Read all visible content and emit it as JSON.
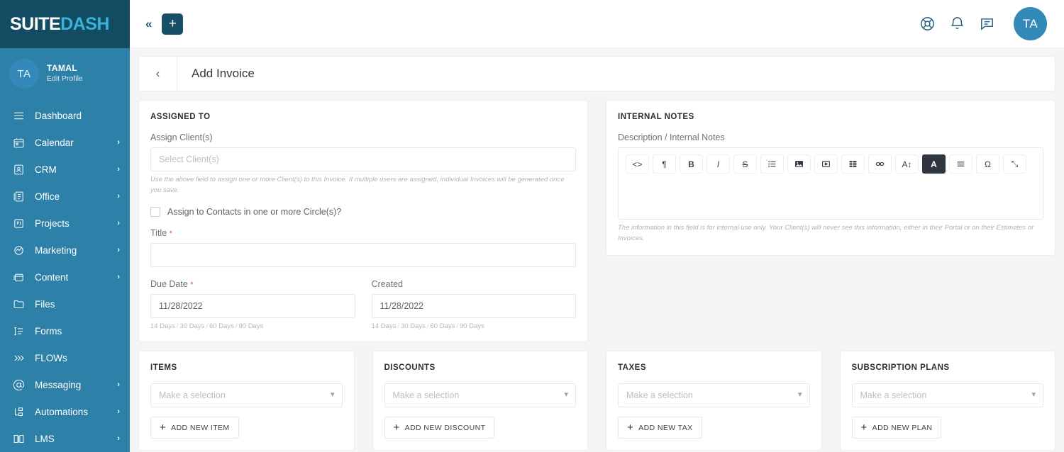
{
  "brand": {
    "logo_part1": "SUITE",
    "logo_part2": "DASH",
    "accent_dark": "#134b63",
    "accent_blue": "#2d80a8",
    "avatar_blue": "#3389b8"
  },
  "sidebar": {
    "profile": {
      "initials": "TA",
      "name": "TAMAL",
      "subtitle": "Edit Profile"
    },
    "items": [
      {
        "label": "Dashboard",
        "icon": "hamburger-icon",
        "caret": ""
      },
      {
        "label": "Calendar",
        "icon": "calendar-icon",
        "caret": "›"
      },
      {
        "label": "CRM",
        "icon": "contact-card-icon",
        "caret": "›"
      },
      {
        "label": "Office",
        "icon": "office-document-icon",
        "caret": "›"
      },
      {
        "label": "Projects",
        "icon": "projects-board-icon",
        "caret": "›"
      },
      {
        "label": "Marketing",
        "icon": "marketing-megaphone-icon",
        "caret": "›"
      },
      {
        "label": "Content",
        "icon": "content-window-icon",
        "caret": "›"
      },
      {
        "label": "Files",
        "icon": "folder-icon",
        "caret": ""
      },
      {
        "label": "Forms",
        "icon": "forms-list-icon",
        "caret": ""
      },
      {
        "label": "FLOWs",
        "icon": "chevrons-right-icon",
        "caret": ""
      },
      {
        "label": "Messaging",
        "icon": "at-sign-icon",
        "caret": "›"
      },
      {
        "label": "Automations",
        "icon": "automations-node-icon",
        "caret": "›"
      },
      {
        "label": "LMS",
        "icon": "book-icon",
        "caret": "›"
      }
    ]
  },
  "topbar": {
    "collapse_label": "«",
    "add_label": "+",
    "icons": [
      "life-ring-icon",
      "bell-icon",
      "chat-icon"
    ],
    "avatar_initials": "TA"
  },
  "page": {
    "back_label": "‹",
    "title": "Add Invoice"
  },
  "assigned_to": {
    "card_title": "ASSIGNED TO",
    "assign_label": "Assign Client(s)",
    "assign_placeholder": "Select Client(s)",
    "assign_value": "",
    "assign_help": "Use the above field to assign one or more Client(s) to this Invoice. If multiple users are assigned, individual Invoices will be generated once you save.",
    "circle_checkbox_label": "Assign to Contacts in one or more Circle(s)?",
    "title_label": "Title",
    "title_required": "*",
    "title_value": "",
    "due_date_label": "Due Date",
    "due_date_required": "*",
    "due_date_value": "11/28/2022",
    "created_label": "Created",
    "created_value": "11/28/2022",
    "day_links": [
      "14 Days",
      "30 Days",
      "60 Days",
      "90 Days"
    ],
    "day_sep": "/"
  },
  "internal_notes": {
    "card_title": "INTERNAL NOTES",
    "field_label": "Description / Internal Notes",
    "content": "",
    "help": "The information in this field is for internal use only. Your Client(s) will never see this information, either in their Portal or on their Estimates or Invoices.",
    "toolbar": [
      {
        "name": "code-icon",
        "glyph": "<>"
      },
      {
        "name": "paragraph-icon",
        "glyph": "¶"
      },
      {
        "name": "bold-icon",
        "glyph": "B"
      },
      {
        "name": "italic-icon",
        "glyph": "I"
      },
      {
        "name": "strikethrough-icon",
        "glyph": "S"
      },
      {
        "name": "bullet-list-icon",
        "glyph": "☰"
      },
      {
        "name": "image-icon",
        "glyph": "▣"
      },
      {
        "name": "video-icon",
        "glyph": "▶"
      },
      {
        "name": "table-icon",
        "glyph": "▒"
      },
      {
        "name": "link-icon",
        "glyph": "∞"
      },
      {
        "name": "font-size-icon",
        "glyph": "A↕"
      },
      {
        "name": "text-color-icon",
        "glyph": "A"
      },
      {
        "name": "align-icon",
        "glyph": "≡"
      },
      {
        "name": "special-character-icon",
        "glyph": "Ω"
      },
      {
        "name": "fullscreen-icon",
        "glyph": "⤡"
      }
    ]
  },
  "bottom_cards": [
    {
      "title": "ITEMS",
      "select_placeholder": "Make a selection",
      "select_value": "",
      "button_label": "ADD NEW ITEM",
      "button_plus": "+"
    },
    {
      "title": "DISCOUNTS",
      "select_placeholder": "Make a selection",
      "select_value": "",
      "button_label": "ADD NEW DISCOUNT",
      "button_plus": "+"
    },
    {
      "title": "TAXES",
      "select_placeholder": "Make a selection",
      "select_value": "",
      "button_label": "ADD NEW TAX",
      "button_plus": "+"
    },
    {
      "title": "SUBSCRIPTION PLANS",
      "select_placeholder": "Make a selection",
      "select_value": "",
      "button_label": "ADD NEW PLAN",
      "button_plus": "+"
    }
  ]
}
